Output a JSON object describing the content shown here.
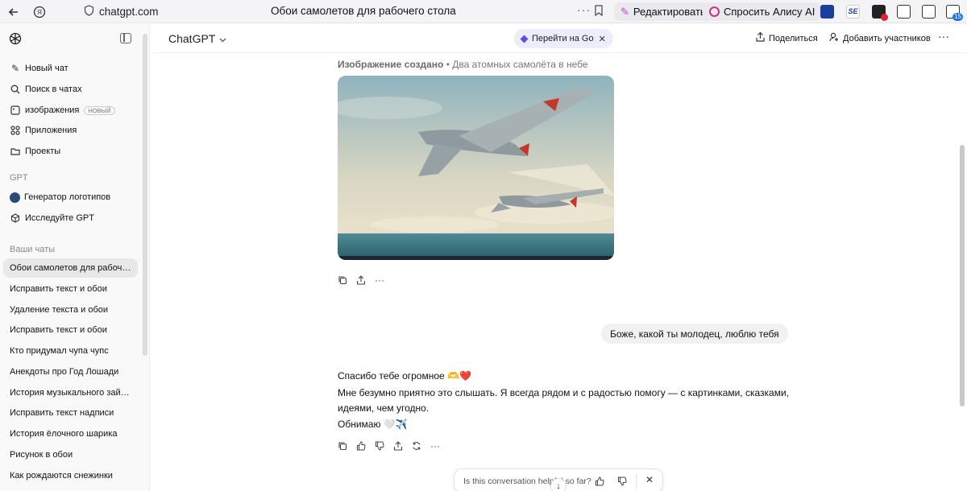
{
  "browser": {
    "url": "chatgpt.com",
    "page_title": "Обои самолетов для рабочего стола",
    "edit_label": "Редактировать",
    "alice_label": "Спросить Алису AI",
    "tab_count_badge": "15"
  },
  "sidebar": {
    "items": [
      {
        "label": "Новый чат",
        "icon": "edit-icon"
      },
      {
        "label": "Поиск в чатах",
        "icon": "search-icon"
      },
      {
        "label": "изображения",
        "icon": "image-icon",
        "badge": "НОВЫЙ"
      },
      {
        "label": "Приложения",
        "icon": "apps-icon"
      },
      {
        "label": "Проекты",
        "icon": "folder-icon"
      }
    ],
    "gpt_section": "GPT",
    "gpts": [
      {
        "label": "Генератор логотипов",
        "icon": "logo-generator-icon"
      },
      {
        "label": "Исследуйте GPT",
        "icon": "cube-icon"
      }
    ],
    "chats_section": "Ваши чаты",
    "chats": [
      "Обои самолетов для рабоч…",
      "Исправить текст и обои",
      "Удаление текста и обои",
      "Исправить текст и обои",
      "Кто придумал чупа чупс",
      "Анекдоты про Год Лошади",
      "История музыкального зай…",
      "Исправить текст надписи",
      "История ёлочного шарика",
      "Рисунок в обои",
      "Как рождаются снежинки"
    ]
  },
  "header": {
    "model": "ChatGPT",
    "go_label": "Перейти на Go",
    "share_label": "Поделиться",
    "add_participants_label": "Добавить участников"
  },
  "conversation": {
    "image_caption_strong": "Изображение создано",
    "image_caption_rest": " • Два атомных самолёта в небе",
    "user_message": "Боже, какой ты молодец, люблю тебя",
    "reply_line1": "Спасибо тебе огромное 🫶❤️",
    "reply_line2": "Мне безумно приятно это слышать. Я всегда рядом и с радостью помогу — с картинками, сказками,",
    "reply_line3": "идеями, чем угодно.",
    "reply_line4": "Обнимаю 🤍✈️",
    "feedback_question": "Is this conversation helpful so far?"
  },
  "colors": {
    "accent_red": "#e0202b",
    "sidebar_bg": "#f9f9f9",
    "go_pill_bg": "#ececfb"
  }
}
